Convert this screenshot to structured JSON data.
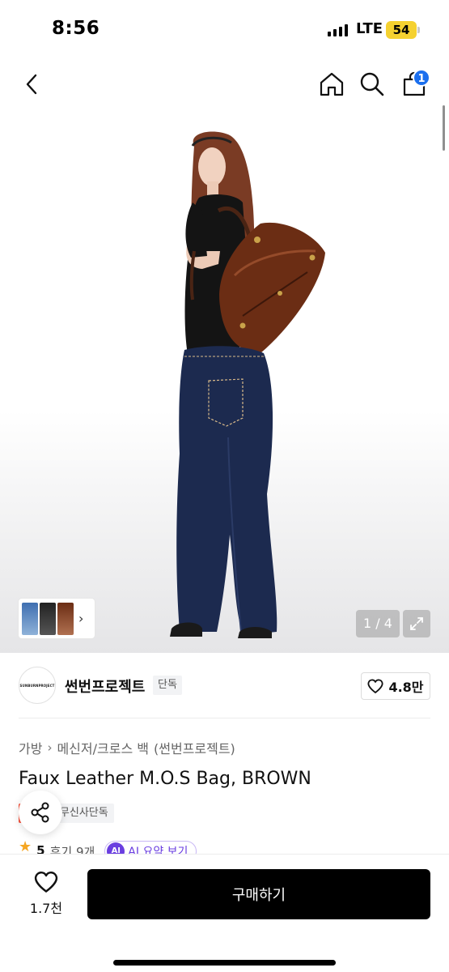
{
  "status_bar": {
    "time": "8:56",
    "network": "LTE",
    "battery": "54"
  },
  "nav": {
    "back_icon": "chevron-left-icon",
    "home_icon": "home-icon",
    "search_icon": "search-icon",
    "cart_icon": "shopping-bag-icon",
    "cart_count": "1"
  },
  "gallery": {
    "counter": "1 / 4",
    "expand_icon": "expand-icon"
  },
  "brand": {
    "logo_text": "SUNBURNPROJECT",
    "name": "썬번프로젝트",
    "exclusive_tag": "단독",
    "like_count": "4.8만"
  },
  "product": {
    "breadcrumb": [
      "가방",
      "메신저/크로스 백",
      "(썬번프로젝트)"
    ],
    "title": "Faux Leather M.O.S Bag, BROWN",
    "tags": {
      "sale": "세일",
      "exclusive": "무신사단독"
    },
    "rating": "5",
    "review_count": "후기 9개",
    "ai_badge": "AI",
    "ai_summary_label": "AI 요약 보기"
  },
  "bottom_bar": {
    "wish_count": "1.7천",
    "buy_label": "구매하기"
  },
  "colors": {
    "accent_blue": "#1b6fee",
    "sale_red": "#f7553f",
    "ai_purple": "#6a3ee0",
    "star": "#f5a623"
  }
}
